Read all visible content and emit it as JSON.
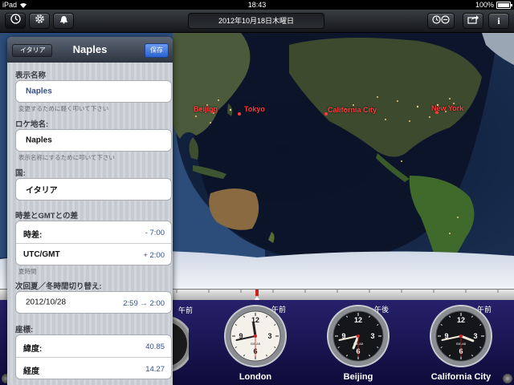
{
  "status_bar": {
    "device": "iPad",
    "time": "18:43",
    "battery": "100%",
    "battery_level": 1.0
  },
  "toolbar": {
    "date": "2012年10月18日木曜日",
    "left_buttons": [
      "clock-icon",
      "gear-icon",
      "alarm-bell-icon"
    ],
    "right_buttons": [
      "dual-clock-icon",
      "share-icon",
      "info-icon"
    ],
    "info_label": "i"
  },
  "map": {
    "cities": [
      {
        "name": "Beijing"
      },
      {
        "name": "Tokyo"
      },
      {
        "name": "California City"
      },
      {
        "name": "New York"
      }
    ],
    "label_color": "#ff3a3a"
  },
  "panel": {
    "back_label": "イタリア",
    "title": "Naples",
    "save_label": "保存",
    "display_name": {
      "section": "表示名称",
      "value": "Naples",
      "hint": "変更するために軽く叩いて下さい"
    },
    "location_name": {
      "section": "ロケ地名:",
      "value": "Naples",
      "hint": "表示名称にするために叩いて下さい"
    },
    "country": {
      "section": "国:",
      "value": "イタリア"
    },
    "timezone": {
      "section": "時差とGMTとの差",
      "rows": [
        {
          "label": "時差:",
          "value": "- 7:00"
        },
        {
          "label": "UTC/GMT",
          "value": "+ 2:00"
        }
      ],
      "hint": "夏時間"
    },
    "dst": {
      "section": "次回夏／冬時間切り替え:",
      "date": "2012/10/28",
      "change": "2:59 →  2:00"
    },
    "coords": {
      "section": "座標:",
      "rows": [
        {
          "label": "緯度:",
          "value": "40.85"
        },
        {
          "label": "経度",
          "value": "14.27"
        }
      ]
    }
  },
  "clocks": [
    {
      "name": "London",
      "ampm": "午前",
      "hour": 11,
      "minute": 43,
      "second": 30,
      "face": "white"
    },
    {
      "name": "Beijing",
      "ampm": "午後",
      "hour": 6,
      "minute": 43,
      "second": 30,
      "face": "black"
    },
    {
      "name": "California City",
      "ampm": "午前",
      "hour": 3,
      "minute": 43,
      "second": 30,
      "face": "black"
    }
  ],
  "partial_clock": {
    "ampm": "午前"
  },
  "clock_numbers": [
    "12",
    "3",
    "6",
    "9"
  ],
  "brand_label": "EMLAB"
}
